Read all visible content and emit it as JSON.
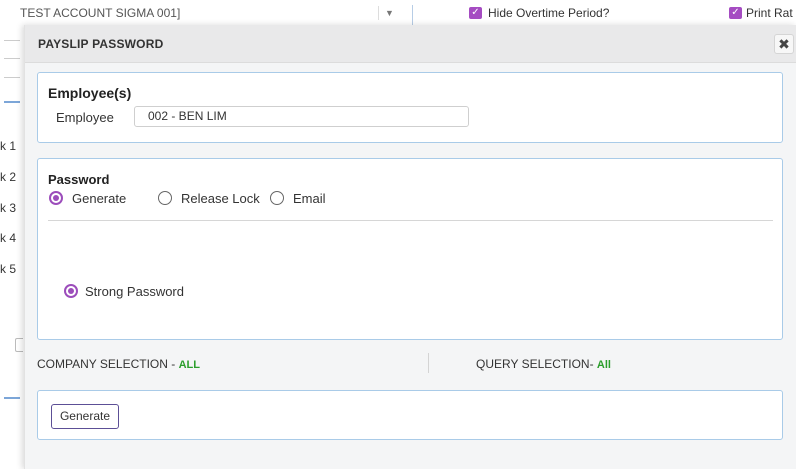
{
  "background": {
    "account_text": "TEST ACCOUNT SIGMA 001]",
    "dropdown_arrow": "▼",
    "hide_overtime_label": "Hide Overtime Period?",
    "print_rate_label": "Print Rat",
    "side_items": [
      "k 1",
      "k 2",
      "k 3",
      "k 4",
      "k 5"
    ]
  },
  "modal": {
    "title": "PAYSLIP PASSWORD",
    "close_glyph": "✖"
  },
  "employee_section": {
    "heading": "Employee(s)",
    "label": "Employee",
    "value": "002 - BEN LIM"
  },
  "password_section": {
    "heading": "Password",
    "options": [
      {
        "label": "Generate",
        "selected": true
      },
      {
        "label": "Release Lock",
        "selected": false
      },
      {
        "label": "Email",
        "selected": false
      }
    ],
    "strong_password_label": "Strong Password",
    "strong_password_selected": true
  },
  "selection": {
    "company_label": "COMPANY SELECTION - ",
    "company_value": "ALL",
    "query_label": "QUERY SELECTION- ",
    "query_value": "All"
  },
  "actions": {
    "generate_label": "Generate"
  },
  "colors": {
    "accent_purple": "#9c4dbb",
    "panel_border": "#a9cbe8",
    "selection_value_green": "#2c9e2c"
  }
}
